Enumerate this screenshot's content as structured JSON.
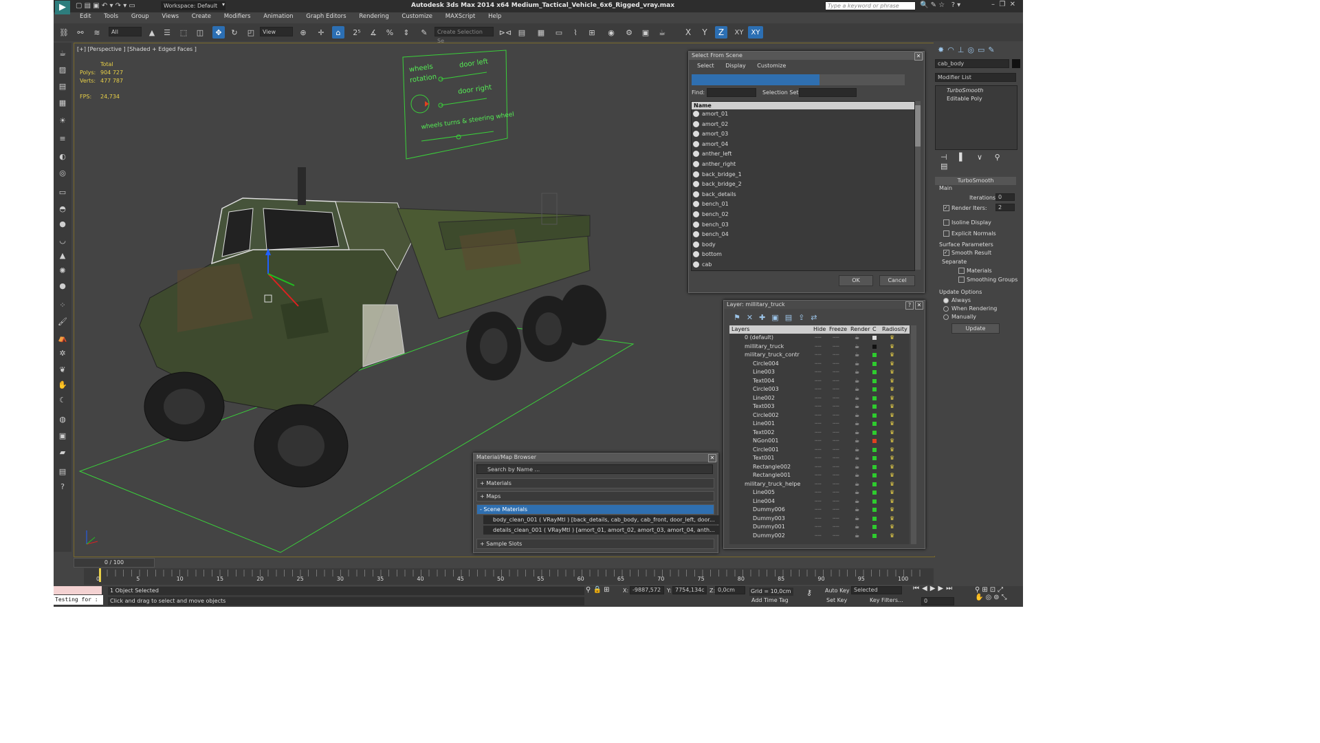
{
  "window": {
    "title": "Autodesk 3ds Max  2014 x64     Medium_Tactical_Vehicle_6x6_Rigged_vray.max",
    "workspace": "Workspace: Default",
    "search_placeholder": "Type a keyword or phrase"
  },
  "menu": [
    "Edit",
    "Tools",
    "Group",
    "Views",
    "Create",
    "Modifiers",
    "Animation",
    "Graph Editors",
    "Rendering",
    "Customize",
    "MAXScript",
    "Help"
  ],
  "toolbar": {
    "filter_value": "All",
    "view_value": "View",
    "selection_set_placeholder": "Create Selection Se",
    "axes": [
      "X",
      "Y",
      "Z",
      "XY",
      "XY"
    ]
  },
  "viewport": {
    "label": "[+] [Perspective ] [Shaded + Edged Faces ]",
    "stats_total": "Total",
    "polys_label": "Polys:",
    "polys_value": "904 727",
    "verts_label": "Verts:",
    "verts_value": "477 787",
    "fps_label": "FPS:",
    "fps_value": "24,734",
    "panel_texts": [
      "wheels",
      "rotation",
      "door left",
      "door right",
      "wheels turns & steering wheel"
    ]
  },
  "select_from_scene": {
    "title": "Select From Scene",
    "menu": [
      "Select",
      "Display",
      "Customize"
    ],
    "find_label": "Find:",
    "selection_set_label": "Selection Set:",
    "column_name": "Name",
    "items": [
      "amort_01",
      "amort_02",
      "amort_03",
      "amort_04",
      "anther_left",
      "anther_right",
      "back_bridge_1",
      "back_bridge_2",
      "back_details",
      "bench_01",
      "bench_02",
      "bench_03",
      "bench_04",
      "body",
      "bottom",
      "cab"
    ],
    "ok": "OK",
    "cancel": "Cancel"
  },
  "layer_dialog": {
    "title": "Layer: millitary_truck",
    "columns": [
      "Layers",
      "Hide",
      "Freeze",
      "Render",
      "C",
      "Radiosity"
    ],
    "rows": [
      {
        "name": "0 (default)",
        "indent": 0,
        "color": "#dddddd"
      },
      {
        "name": "millitary_truck",
        "indent": 0,
        "color": "#111111"
      },
      {
        "name": "military_truck_contr",
        "indent": 0,
        "color": "#2ecc2e"
      },
      {
        "name": "Circle004",
        "indent": 1,
        "color": "#2ecc2e"
      },
      {
        "name": "Line003",
        "indent": 1,
        "color": "#2ecc2e"
      },
      {
        "name": "Text004",
        "indent": 1,
        "color": "#2ecc2e"
      },
      {
        "name": "Circle003",
        "indent": 1,
        "color": "#2ecc2e"
      },
      {
        "name": "Line002",
        "indent": 1,
        "color": "#2ecc2e"
      },
      {
        "name": "Text003",
        "indent": 1,
        "color": "#2ecc2e"
      },
      {
        "name": "Circle002",
        "indent": 1,
        "color": "#2ecc2e"
      },
      {
        "name": "Line001",
        "indent": 1,
        "color": "#2ecc2e"
      },
      {
        "name": "Text002",
        "indent": 1,
        "color": "#2ecc2e"
      },
      {
        "name": "NGon001",
        "indent": 1,
        "color": "#e04020"
      },
      {
        "name": "Circle001",
        "indent": 1,
        "color": "#2ecc2e"
      },
      {
        "name": "Text001",
        "indent": 1,
        "color": "#2ecc2e"
      },
      {
        "name": "Rectangle002",
        "indent": 1,
        "color": "#2ecc2e"
      },
      {
        "name": "Rectangle001",
        "indent": 1,
        "color": "#2ecc2e"
      },
      {
        "name": "military_truck_helpe",
        "indent": 0,
        "color": "#2ecc2e"
      },
      {
        "name": "Line005",
        "indent": 1,
        "color": "#2ecc2e"
      },
      {
        "name": "Line004",
        "indent": 1,
        "color": "#2ecc2e"
      },
      {
        "name": "Dummy006",
        "indent": 1,
        "color": "#2ecc2e"
      },
      {
        "name": "Dummy003",
        "indent": 1,
        "color": "#2ecc2e"
      },
      {
        "name": "Dummy001",
        "indent": 1,
        "color": "#2ecc2e"
      },
      {
        "name": "Dummy002",
        "indent": 1,
        "color": "#2ecc2e"
      }
    ]
  },
  "material_browser": {
    "title": "Material/Map Browser",
    "search_placeholder": "Search by Name ...",
    "materials": "+ Materials",
    "maps": "+ Maps",
    "scene_materials": "- Scene Materials",
    "mat1": "body_clean_001  ( VRayMtl )  [back_details, cab_body, cab_front, door_left, door...",
    "mat2": "details_clean_001  ( VRayMtl )  [amort_01, amort_02, amort_03, amort_04, anth...",
    "sample_slots": "+ Sample Slots"
  },
  "command_panel": {
    "object_name": "cab_body",
    "modifier_list": "Modifier List",
    "stack": [
      "TurboSmooth",
      "Editable Poly"
    ],
    "rollout_title": "TurboSmooth",
    "main_label": "Main",
    "iterations_label": "Iterations:",
    "iterations_value": "0",
    "render_iters_label": "Render Iters:",
    "render_iters_value": "2",
    "isoline": "Isoline Display",
    "explicit": "Explicit Normals",
    "surface_params": "Surface Parameters",
    "smooth_result": "Smooth Result",
    "separate": "Separate",
    "materials": "Materials",
    "smoothing_groups": "Smoothing Groups",
    "update_options": "Update Options",
    "always": "Always",
    "when_rendering": "When Rendering",
    "manually": "Manually",
    "update_btn": "Update"
  },
  "timeline": {
    "frame_counter": "0 / 100",
    "ticks": [
      "0",
      "5",
      "10",
      "15",
      "20",
      "25",
      "30",
      "35",
      "40",
      "45",
      "50",
      "55",
      "60",
      "65",
      "70",
      "75",
      "80",
      "85",
      "90",
      "95",
      "100"
    ]
  },
  "status": {
    "maxscript": "Testing for :",
    "selection": "1 Object Selected",
    "prompt": "Click and drag to select and move objects",
    "x_label": "X:",
    "x_value": "-9887,572",
    "y_label": "Y:",
    "y_value": "7754,134c",
    "z_label": "Z:",
    "z_value": "0,0cm",
    "grid": "Grid = 10,0cm",
    "add_time_tag": "Add Time Tag",
    "auto_key": "Auto Key",
    "selected": "Selected",
    "set_key": "Set Key",
    "key_filters": "Key Filters...",
    "frame_value": "0"
  }
}
